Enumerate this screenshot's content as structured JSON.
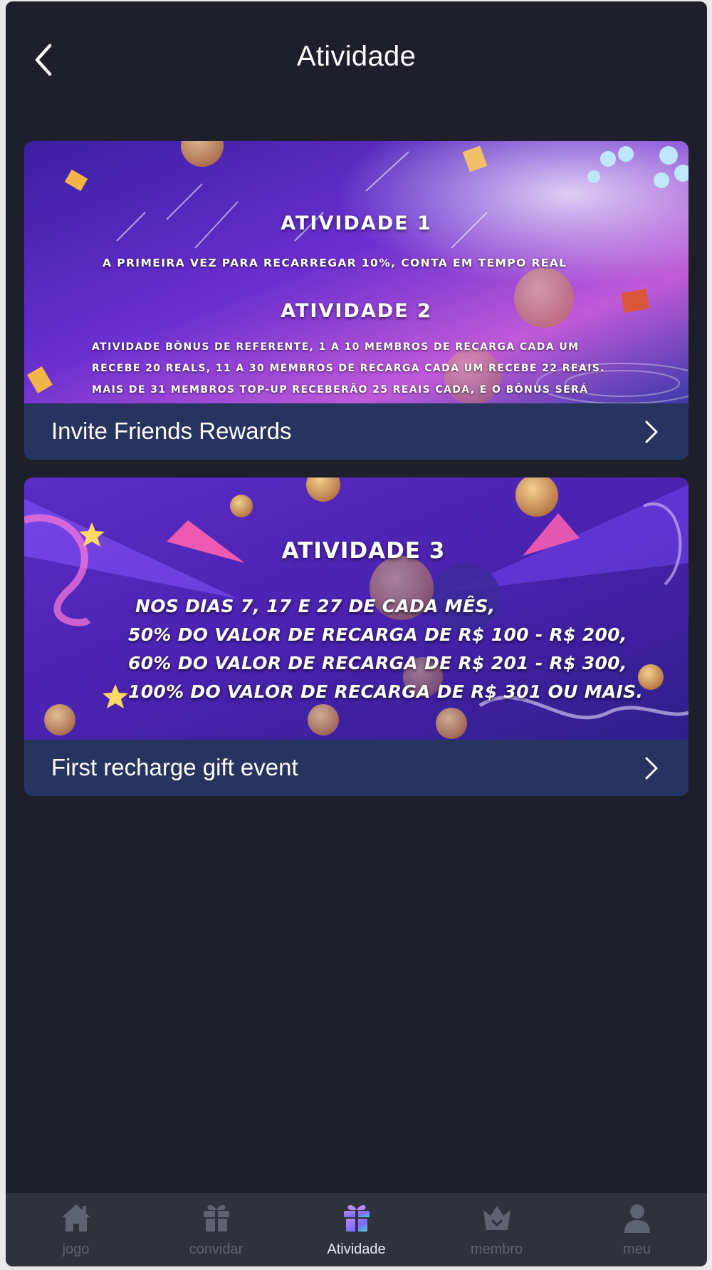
{
  "header": {
    "title": "Atividade"
  },
  "cards": [
    {
      "label": "Invite Friends Rewards",
      "banner": {
        "heading1": "ATIVIDADE 1",
        "line1": "A PRIMEIRA VEZ PARA RECARREGAR 10%, CONTA EM TEMPO REAL",
        "heading2": "ATIVIDADE 2",
        "line2": "ATIVIDADE BÔNUS DE REFERENTE, 1 A 10 MEMBROS DE RECARGA CADA UM",
        "line3": "RECEBE 20 REALS, 11 A 30 MEMBROS DE RECARGA CADA UM RECEBE 22 REAIS.",
        "line4": "MAIS DE 31 MEMBROS TOP-UP RECEBERÃO 25 REAIS CADA, E O BÔNUS SERÁ"
      }
    },
    {
      "label": "First recharge gift event",
      "banner": {
        "heading": "ATIVIDADE 3",
        "line1": "NOS DIAS 7, 17 E 27 DE CADA MÊS,",
        "line2": "50% DO VALOR DE RECARGA DE R$ 100 - R$ 200,",
        "line3": "60% DO VALOR DE RECARGA DE R$ 201 - R$ 300,",
        "line4": "100% DO VALOR DE RECARGA DE R$ 301 OU MAIS."
      }
    }
  ],
  "tabbar": {
    "active": "Atividade",
    "tabs": [
      {
        "label": "jogo",
        "icon": "home-icon"
      },
      {
        "label": "convidar",
        "icon": "gift-icon"
      },
      {
        "label": "Atividade",
        "icon": "gift-icon"
      },
      {
        "label": "membro",
        "icon": "crown-icon"
      },
      {
        "label": "meu",
        "icon": "user-icon"
      }
    ]
  },
  "colors": {
    "background": "#1e1f2a",
    "card_footer": "#27345f",
    "tabbar": "#2f313d",
    "tab_inactive": "#5f6270",
    "tab_active": "#e9e9f2"
  }
}
